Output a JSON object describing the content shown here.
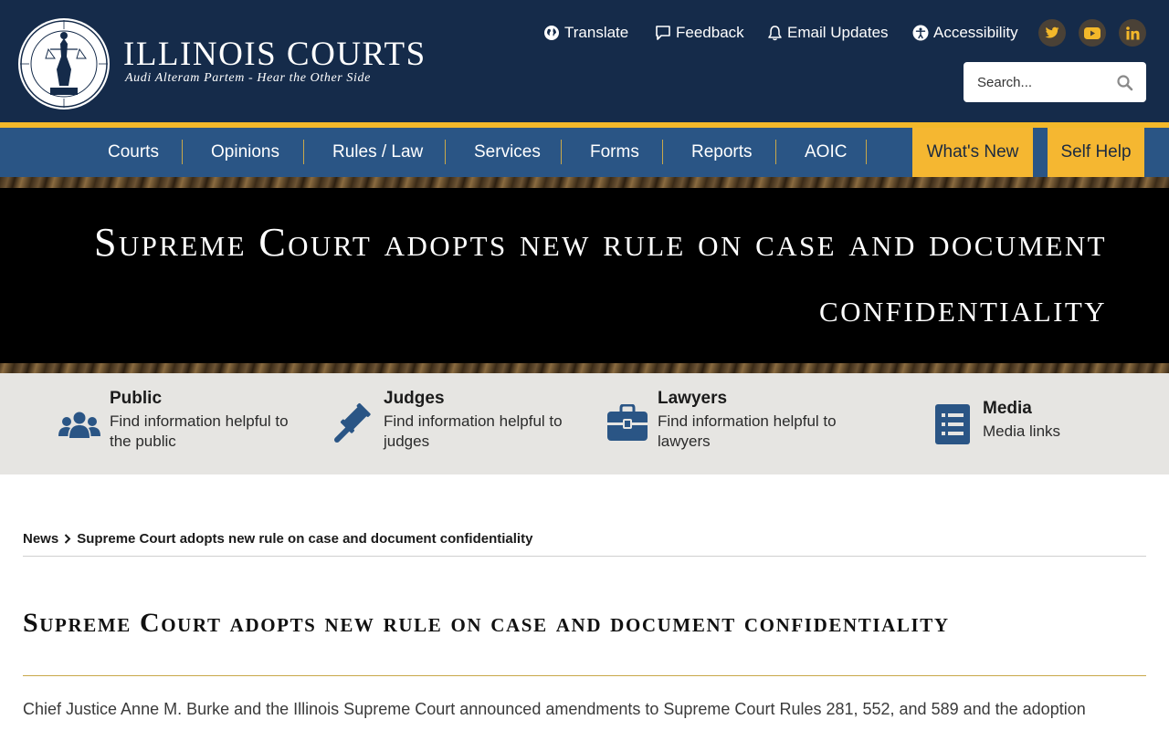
{
  "site": {
    "title": "ILLINOIS COURTS",
    "tagline": "Audi Alteram Partem - Hear the Other Side"
  },
  "utility_links": [
    {
      "label": "Translate",
      "icon": "globe-icon"
    },
    {
      "label": "Feedback",
      "icon": "chat-bubble-icon"
    },
    {
      "label": "Email Updates",
      "icon": "bell-icon"
    },
    {
      "label": "Accessibility",
      "icon": "accessibility-icon"
    }
  ],
  "social": [
    "twitter-icon",
    "youtube-icon",
    "linkedin-icon"
  ],
  "search": {
    "placeholder": "Search..."
  },
  "nav": {
    "items": [
      "Courts",
      "Opinions",
      "Rules / Law",
      "Services",
      "Forms",
      "Reports",
      "AOIC"
    ],
    "highlight": [
      "What's New",
      "Self Help"
    ]
  },
  "hero": {
    "title": "Supreme Court adopts new rule on case and document confidentiality"
  },
  "audience": [
    {
      "title": "Public",
      "desc": "Find information helpful to the public",
      "icon": "people-icon"
    },
    {
      "title": "Judges",
      "desc": "Find information helpful to judges",
      "icon": "gavel-icon"
    },
    {
      "title": "Lawyers",
      "desc": "Find information helpful to lawyers",
      "icon": "briefcase-icon"
    },
    {
      "title": "Media",
      "desc": "Media links",
      "icon": "list-icon"
    }
  ],
  "breadcrumb": {
    "parent": "News",
    "current": "Supreme Court adopts new rule on case and document confidentiality"
  },
  "article": {
    "title": "Supreme Court adopts new rule on case and document confidentiality",
    "body": "Chief Justice Anne M. Burke and the Illinois Supreme Court announced amendments to Supreme Court Rules 281, 552, and 589 and the adoption"
  },
  "colors": {
    "header_bg": "#152b4a",
    "nav_bg": "#2a5585",
    "accent_gold": "#f5b731",
    "audience_bg": "#e6e5e2",
    "icon_blue": "#2a5585"
  }
}
